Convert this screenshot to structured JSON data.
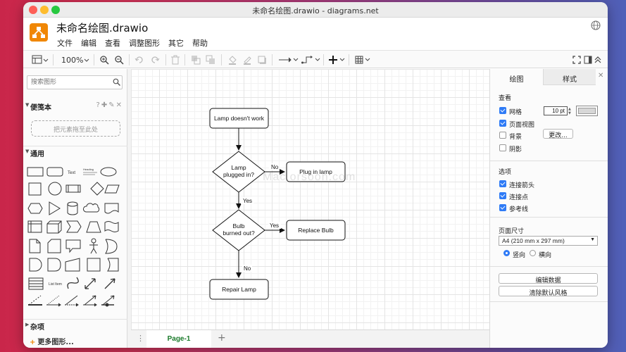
{
  "window": {
    "title": "未命名绘图.drawio - diagrams.net"
  },
  "header": {
    "doc_title": "未命名绘图.drawio",
    "menu": [
      "文件",
      "编辑",
      "查看",
      "调整图形",
      "其它",
      "帮助"
    ]
  },
  "toolbar": {
    "zoom": "100%"
  },
  "sidebar": {
    "search_placeholder": "搜索图形",
    "scratchpad": {
      "label": "便笺本",
      "tools": "?✚✎✕",
      "drop_text": "把元素拖至此处"
    },
    "general": {
      "label": "通用"
    },
    "shape_texts": {
      "text": "Text",
      "heading": "Heading",
      "list_item": "List Item"
    },
    "misc": {
      "label": "杂项"
    },
    "more_shapes": "更多图形..."
  },
  "diagram": {
    "nodes": {
      "start": "Lamp doesn't work",
      "plugged_line1": "Lamp",
      "plugged_line2": "plugged in?",
      "plug": "Plug in lamp",
      "burned_line1": "Bulb",
      "burned_line2": "burned out?",
      "replace": "Replace Bulb",
      "repair": "Repair Lamp"
    },
    "edges": {
      "no1": "No",
      "yes1": "Yes",
      "yes2": "Yes",
      "no2": "No"
    }
  },
  "watermark": "Mac.orsoon.com",
  "pages": {
    "tab": "Page-1"
  },
  "panel": {
    "tabs": [
      "绘图",
      "样式"
    ],
    "view": {
      "title": "查看",
      "grid": "网格",
      "grid_size": "10 pt",
      "page_view": "页面视图",
      "background": "背景",
      "change_button": "更改...",
      "shadow": "阴影"
    },
    "options": {
      "title": "选项",
      "connection_arrows": "连接箭头",
      "connection_points": "连接点",
      "guides": "参考线"
    },
    "page_size": {
      "title": "页面尺寸",
      "selected": "A4 (210 mm x 297 mm)",
      "portrait": "竖向",
      "landscape": "横向"
    },
    "buttons": {
      "edit_data": "编辑数据",
      "clear_style": "清除默认风格"
    }
  },
  "colors": {
    "accent": "#f08705",
    "checkbox": "#2f7bf6",
    "page_tab_text": "#1a7a2a"
  }
}
